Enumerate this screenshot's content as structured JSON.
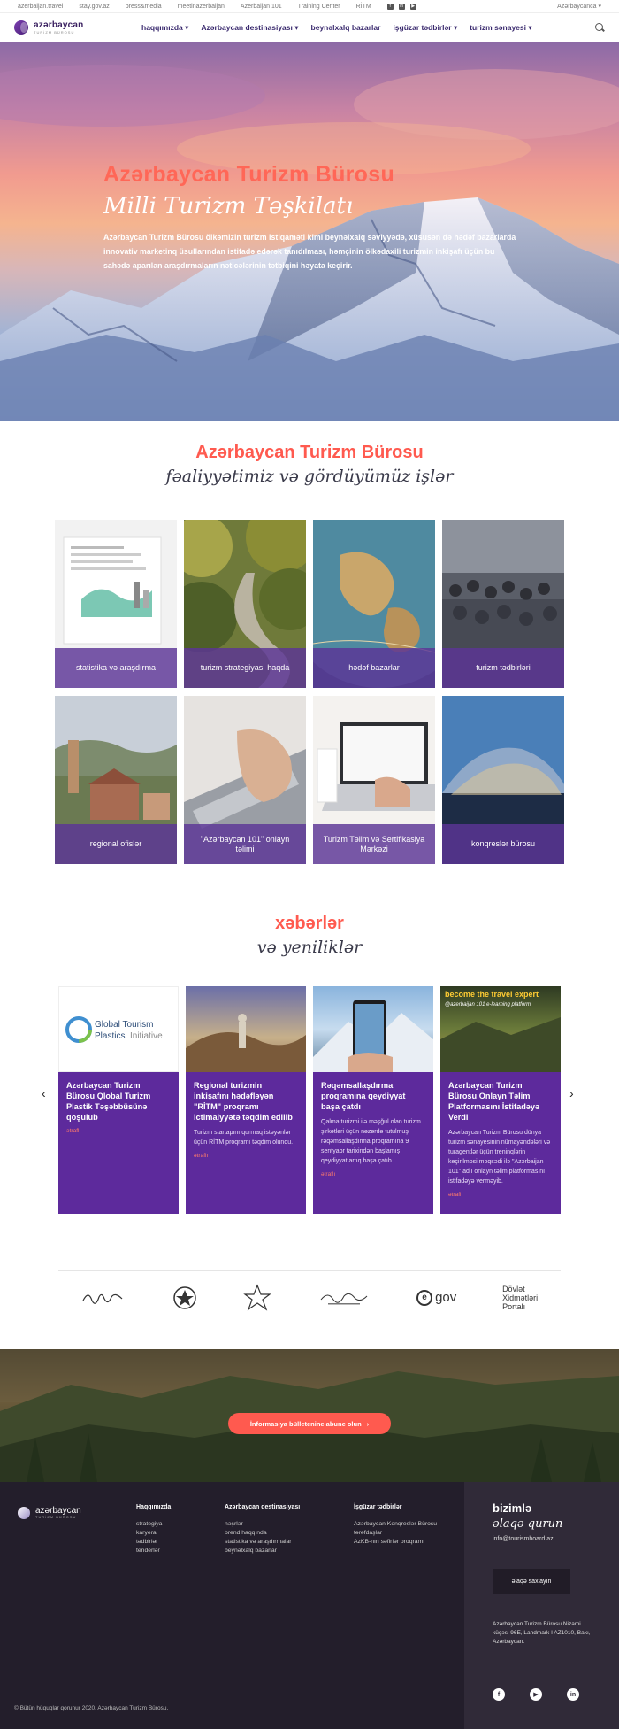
{
  "topbar": {
    "links": [
      "azerbaijan.travel",
      "stay.gov.az",
      "press&media",
      "meetinazerbaijan",
      "Azerbaijan 101",
      "Training Center",
      "RİTM"
    ],
    "language": "Azərbaycanca"
  },
  "nav": {
    "logo_name": "azərbaycan",
    "logo_sub": "TURİZM BÜROSU",
    "items": [
      "haqqımızda",
      "Azərbaycan destinasiyası",
      "beynəlxalq bazarlar",
      "işgüzar tədbirlər",
      "turizm sənayesi"
    ]
  },
  "hero": {
    "title": "Azərbaycan Turizm Bürosu",
    "subtitle": "Milli Turizm Təşkilatı",
    "text": "Azərbaycan Turizm Bürosu ölkəmizin turizm istiqaməti kimi beynəlxalq səviyyədə, xüsusən də hədəf bazarlarda innovativ marketinq üsullarından istifadə edərək tanıdılması, həmçinin ölkədaxili turizmin inkişafı üçün bu sahədə aparılan araşdırmaların nəticələrinin tətbiqini həyata keçirir."
  },
  "activities": {
    "heading": "Azərbaycan Turizm Bürosu",
    "subheading": "fəaliyyətimiz və gördüyümüz işlər",
    "cards": [
      "statistika və araşdırma",
      "turizm strategiyası haqda",
      "hədəf bazarlar",
      "turizm tədbirləri",
      "regional ofislər",
      "\"Azərbaycan 101\" onlayn təlimi",
      "Turizm Təlim və Sertifikasiya Mərkəzi",
      "konqreslər bürosu"
    ]
  },
  "news": {
    "heading": "xəbərlər",
    "subheading": "və yeniliklər",
    "more_label": "ətraflı",
    "image_texts": {
      "plastics_1": "Global Tourism",
      "plastics_2": "Plastics",
      "plastics_3": "Initiative",
      "expert_1": "become the travel expert",
      "expert_2": "@azerbaijan 101 e-learning platform"
    },
    "items": [
      {
        "title": "Azərbaycan Turizm Bürosu Qlobal Turizm Plastik Təşəbbüsünə qoşulub",
        "desc": ""
      },
      {
        "title": "Regional turizmin inkişafını hədəfləyən \"RİTM\" proqramı ictimaiyyətə təqdim edilib",
        "desc": "Turizm startapını qurmaq istəyənlər üçün RİTM proqramı təqdim olundu."
      },
      {
        "title": "Rəqəmsallaşdırma proqramına qeydiyyat başa çatdı",
        "desc": "Qalma turizmi ilə məşğul olan turizm şirkətləri üçün nəzərdə tutulmuş rəqəmsallaşdırma proqramına 9 sentyabr tarixindən başlamış qeydiyyat artıq başa çatıb."
      },
      {
        "title": "Azərbaycan Turizm Bürosu Onlayn Təlim Platformasını İstifadəyə Verdi",
        "desc": "Azərbaycan Turizm Bürosu dünya turizm sənayesinin nümayəndələri və turagentlər üçün treninqlərin keçirilməsi məqsədi ilə \"Azərbaijan 101\" adlı onlayn təlim platformasını istifadəyə verməyib."
      }
    ]
  },
  "partners": {
    "items": [
      "Signature",
      "Emblem",
      "Heydər Əliyev Fondu",
      "Mədəniyyət Nazirliyi",
      "e.gov",
      "Dövlət Xidmətləri Portalı"
    ],
    "egov_e": "e",
    "egov": "gov",
    "dxp": "Dövlət\nXidmətləri\nPortalı"
  },
  "newsletter": {
    "button": "İnformasiya bülletenine abune olun"
  },
  "footer": {
    "logo_name": "azərbaycan",
    "logo_sub": "TURİZM BÜROSU",
    "columns": [
      {
        "heading": "Haqqımızda",
        "items": [
          "strategiya",
          "karyera",
          "tədbirlər",
          "tenderlər"
        ]
      },
      {
        "heading": "Azərbaycan destinasiyası",
        "items": [
          "nəşrlər",
          "brend haqqında",
          "statistika və araşdırmalar",
          "beynəlxalq bazarlar"
        ]
      },
      {
        "heading": "İşgüzar tədbirlər",
        "items": [
          "Azərbaycan Konqreslər Bürosu",
          "tərəfdaşlar",
          "AzKB-nın səfirlər proqramı"
        ]
      }
    ],
    "contact": {
      "title": "bizimlə",
      "subtitle": "əlaqə qurun",
      "email": "info@tourismboard.az",
      "button": "əlaqə saxlayın",
      "address": "Azərbaycan Turizm Bürosu Nizami küçəsi 96E, Landmark I AZ1010, Bakı, Azərbaycan."
    },
    "copyright": "© Bütün hüquqlar qorunur 2020. Azərbaycan Turizm Bürosu."
  }
}
